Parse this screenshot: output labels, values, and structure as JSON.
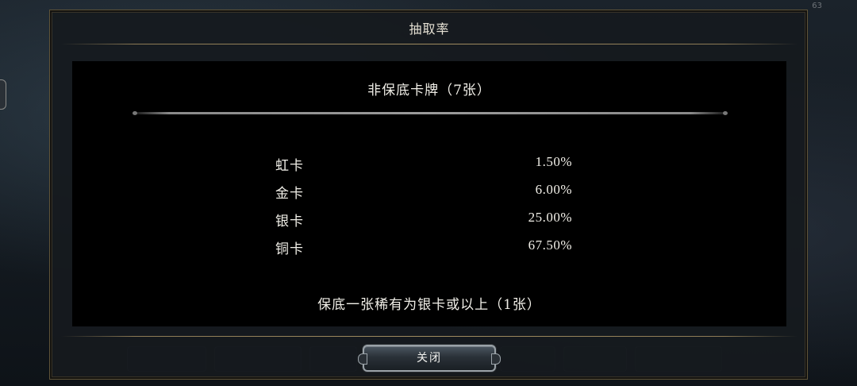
{
  "battery": "63",
  "dialog": {
    "title": "抽取率",
    "section_title": "非保底卡牌（7张）",
    "rates": [
      {
        "name": "虹卡",
        "value": "1.50%"
      },
      {
        "name": "金卡",
        "value": "6.00%"
      },
      {
        "name": "银卡",
        "value": "25.00%"
      },
      {
        "name": "铜卡",
        "value": "67.50%"
      }
    ],
    "guarantee": "保底一张稀有为银卡或以上（1张）",
    "close_label": "关闭"
  }
}
